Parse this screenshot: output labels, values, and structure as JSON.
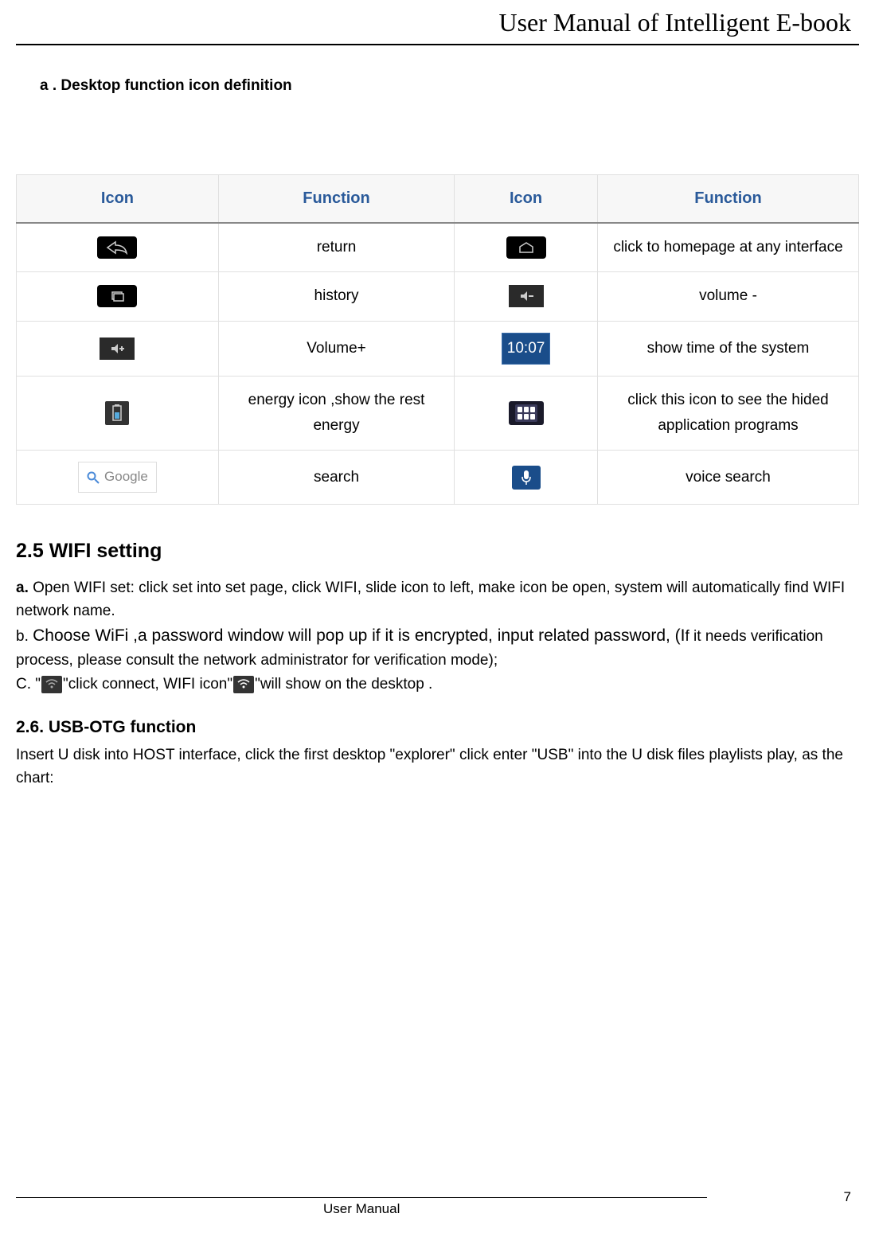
{
  "header_title": "User Manual of Intelligent E-book",
  "section_a_title": "a . Desktop function icon definition",
  "table_headers": {
    "col1": "Icon",
    "col2": "Function",
    "col3": "Icon",
    "col4": "Function"
  },
  "table_rows": [
    {
      "icon_a": "back-icon",
      "func_a": "return",
      "icon_b": "home-icon",
      "func_b": "click to homepage at any interface"
    },
    {
      "icon_a": "recent-apps-icon",
      "func_a": "history",
      "icon_b": "volume-down-icon",
      "func_b": "volume -"
    },
    {
      "icon_a": "volume-up-icon",
      "func_a": "Volume+",
      "icon_b": "clock-icon",
      "icon_b_text": "10:07",
      "func_b": "show time of the system"
    },
    {
      "icon_a": "battery-icon",
      "func_a": "energy icon ,show the rest energy",
      "icon_b": "app-drawer-icon",
      "func_b": "click this icon to see the hided application programs"
    },
    {
      "icon_a": "google-search-icon",
      "icon_a_text": "Google",
      "func_a": "search",
      "icon_b": "voice-search-icon",
      "func_b": "voice search"
    }
  ],
  "wifi": {
    "heading": "2.5 WIFI setting",
    "para_a_prefix": "a.",
    "para_a": " Open WIFI set: click set into set page, click WIFI, slide icon to left, make icon be open, system will automatically find WIFI network name.",
    "para_b_prefix": "b. ",
    "para_b_big": "Choose WiFi ,a password window will pop up if it is encrypted, input related password, (I",
    "para_b_rest": "f it needs verification process, please consult the network administrator for verification mode);",
    "para_c_prefix": "C.",
    "para_c_q1": " \"",
    "para_c_mid": "\"click connect, WIFI icon\"",
    "para_c_end": "\"will show on the desktop ."
  },
  "usb": {
    "heading": "2.6. USB-OTG function",
    "para": "Insert U disk into HOST interface, click the first desktop \"explorer\" click enter \"USB\" into the U disk files playlists play, as the chart:"
  },
  "footer": {
    "label": "User Manual",
    "page": "7"
  }
}
